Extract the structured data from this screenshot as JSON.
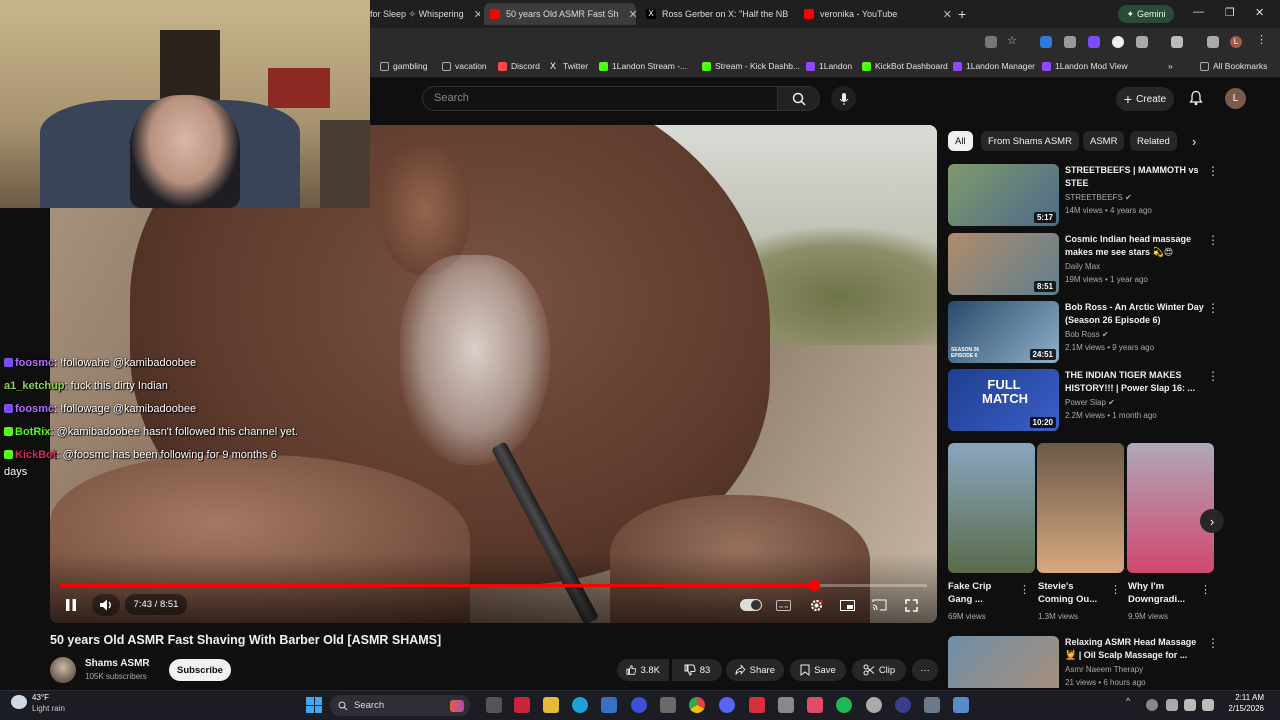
{
  "browser": {
    "tabs": [
      {
        "label": "for Sleep ✧ Whispering",
        "active": false
      },
      {
        "label": "50 years Old ASMR Fast Sh",
        "active": true
      },
      {
        "label": "Ross Gerber on X: \"Half the NB",
        "active": false
      },
      {
        "label": "veronika - YouTube",
        "active": false
      }
    ],
    "new_tab_icon": "plus-icon",
    "gemini_label": "Gemini",
    "profile_initial": "L",
    "bookmarks": [
      "gambling",
      "vacation",
      "Discord",
      "Twitter",
      "1Landon Stream -...",
      "Stream - Kick Dashb...",
      "1Landon",
      "KickBot Dashboard",
      "1Landon Manager",
      "1Landon Mod View"
    ],
    "all_bookmarks": "All Bookmarks",
    "more_bookmarks": "»"
  },
  "youtube": {
    "search_placeholder": "Search",
    "create_label": "Create",
    "avatar_initial": "L"
  },
  "video": {
    "title": "50 years Old ASMR Fast Shaving With Barber Old [ASMR SHAMS]",
    "time": "7:43 / 8:51",
    "progress": 0.87,
    "channel": "Shams ASMR",
    "subscribers": "105K subscribers",
    "subscribe_label": "Subscribe",
    "likes": "3.8K",
    "dislikes": "83",
    "share_label": "Share",
    "save_label": "Save",
    "clip_label": "Clip",
    "more": "···"
  },
  "chips": [
    {
      "label": "All",
      "active": true
    },
    {
      "label": "From Shams ASMR",
      "active": false
    },
    {
      "label": "ASMR",
      "active": false
    },
    {
      "label": "Related",
      "active": false
    }
  ],
  "recommendations": [
    {
      "title": "STREETBEEFS | MAMMOTH vs STEE",
      "channel": "STREETBEEFS",
      "verified": true,
      "meta": "14M views • 4 years ago",
      "duration": "5:17",
      "thumb": "linear-gradient(135deg,#7f9a6b,#4e6a8a)"
    },
    {
      "title": "Cosmic Indian head massage makes me see stars 💫😍",
      "channel": "Daily Max",
      "verified": false,
      "meta": "19M views • 1 year ago",
      "duration": "8:51",
      "thumb": "linear-gradient(135deg,#b08c6a,#5f7f8f)"
    },
    {
      "title": "Bob Ross - An Arctic Winter Day (Season 26 Episode 6)",
      "channel": "Bob Ross",
      "verified": true,
      "meta": "2.1M views • 9 years ago",
      "duration": "24:51",
      "thumb": "linear-gradient(135deg,#2b4a6b,#8fb0c8)"
    },
    {
      "title": "THE INDIAN TIGER MAKES HISTORY!!! | Power Slap 16: ...",
      "channel": "Power Slap",
      "verified": true,
      "meta": "2.2M views • 1 month ago",
      "duration": "10:20",
      "thumb": "linear-gradient(135deg,#1f3f8f,#3a5fc8)"
    },
    {
      "title": "Relaxing ASMR Head Massage 💆 | Oil Scalp Massage for ...",
      "channel": "Asmr Naeem Therapy",
      "verified": false,
      "meta": "21 views • 6 hours ago",
      "duration": "",
      "thumb": "linear-gradient(135deg,#6f8fa8,#a98f7a)"
    }
  ],
  "thumb_overlays": {
    "full_match": "FULL MATCH",
    "season": "SEASON 26 EPISODE 6"
  },
  "shorts": [
    {
      "title": "Fake Crip Gang ...",
      "views": "69M views",
      "thumb": "linear-gradient(180deg,#8aa6c0,#5a6b4a)"
    },
    {
      "title": "Stevie's Coming Ou...",
      "views": "1.3M views",
      "thumb": "linear-gradient(180deg,#6a5a48,#d8a880)"
    },
    {
      "title": "Why I'm Downgradi...",
      "views": "9.9M views",
      "thumb": "linear-gradient(180deg,#b0a8b8,#d04870)"
    }
  ],
  "chat": [
    {
      "user": "foosmc",
      "user_color": "#b06cff",
      "msg": ": !followahe @kamibadoobee",
      "badge": "#7a4dff"
    },
    {
      "user": "a1_ketchup",
      "user_color": "#8bd35a",
      "msg": ": fuck this dirty Indian",
      "badge": ""
    },
    {
      "user": "foosmc",
      "user_color": "#b06cff",
      "msg": ": !followage @kamibadoobee",
      "badge": "#7a4dff"
    },
    {
      "user": "BotRix",
      "user_color": "#53fc18",
      "msg": ": @kamibadoobee hasn't followed this channel yet.",
      "badge": "#53fc18"
    },
    {
      "user": "KickBot",
      "user_color": "#e0245e",
      "msg": ": @foosmc has been following for 9 months 6",
      "badge": "#53fc18"
    }
  ],
  "chat_wrap": "days",
  "taskbar": {
    "temperature": "43°F",
    "condition": "Light rain",
    "search_label": "Search",
    "time": "2:11 AM",
    "date": "2/15/2026"
  }
}
